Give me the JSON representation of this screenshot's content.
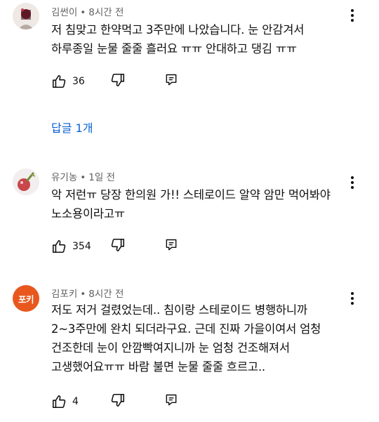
{
  "comments": [
    {
      "author": "김썬이",
      "time": "8시간 전",
      "text": "저 침맞고 한약먹고 3주만에 나았습니다. 눈 안감겨서\n하루종일 눈물 줄줄 흘러요 ㅠㅠ 안대하고 댕김 ㅠㅠ",
      "likes": "36",
      "replies_label": "답글 1개"
    },
    {
      "author": "유기농",
      "time": "1일 전",
      "text": "악 저런ㅠ 당장 한의원 가!! 스테로이드 알약 암만 먹어봐야\n노소용이라고ㅠ",
      "likes": "354"
    },
    {
      "author": "김포키",
      "time": "8시간 전",
      "avatar_text": "포키",
      "text": "저도 저거 걸렸었는데.. 침이랑 스테로이드 병행하니까\n2~3주만에 완치 되더라구요. 근데 진짜 가을이여서 엄청\n건조한데 눈이 안깜빡여지니까 눈 엄청 건조해져서\n고생했어요ㅠㅠ 바람 불면 눈물 줄줄 흐르고..",
      "likes": "4"
    }
  ],
  "icons": {
    "like": "thumbs-up-icon",
    "dislike": "thumbs-down-icon",
    "reply": "reply-comment-icon",
    "more": "more-vertical-icon"
  },
  "colors": {
    "link_blue": "#065fd4",
    "meta_gray": "#606060",
    "avatar_orange": "#e8581e"
  }
}
